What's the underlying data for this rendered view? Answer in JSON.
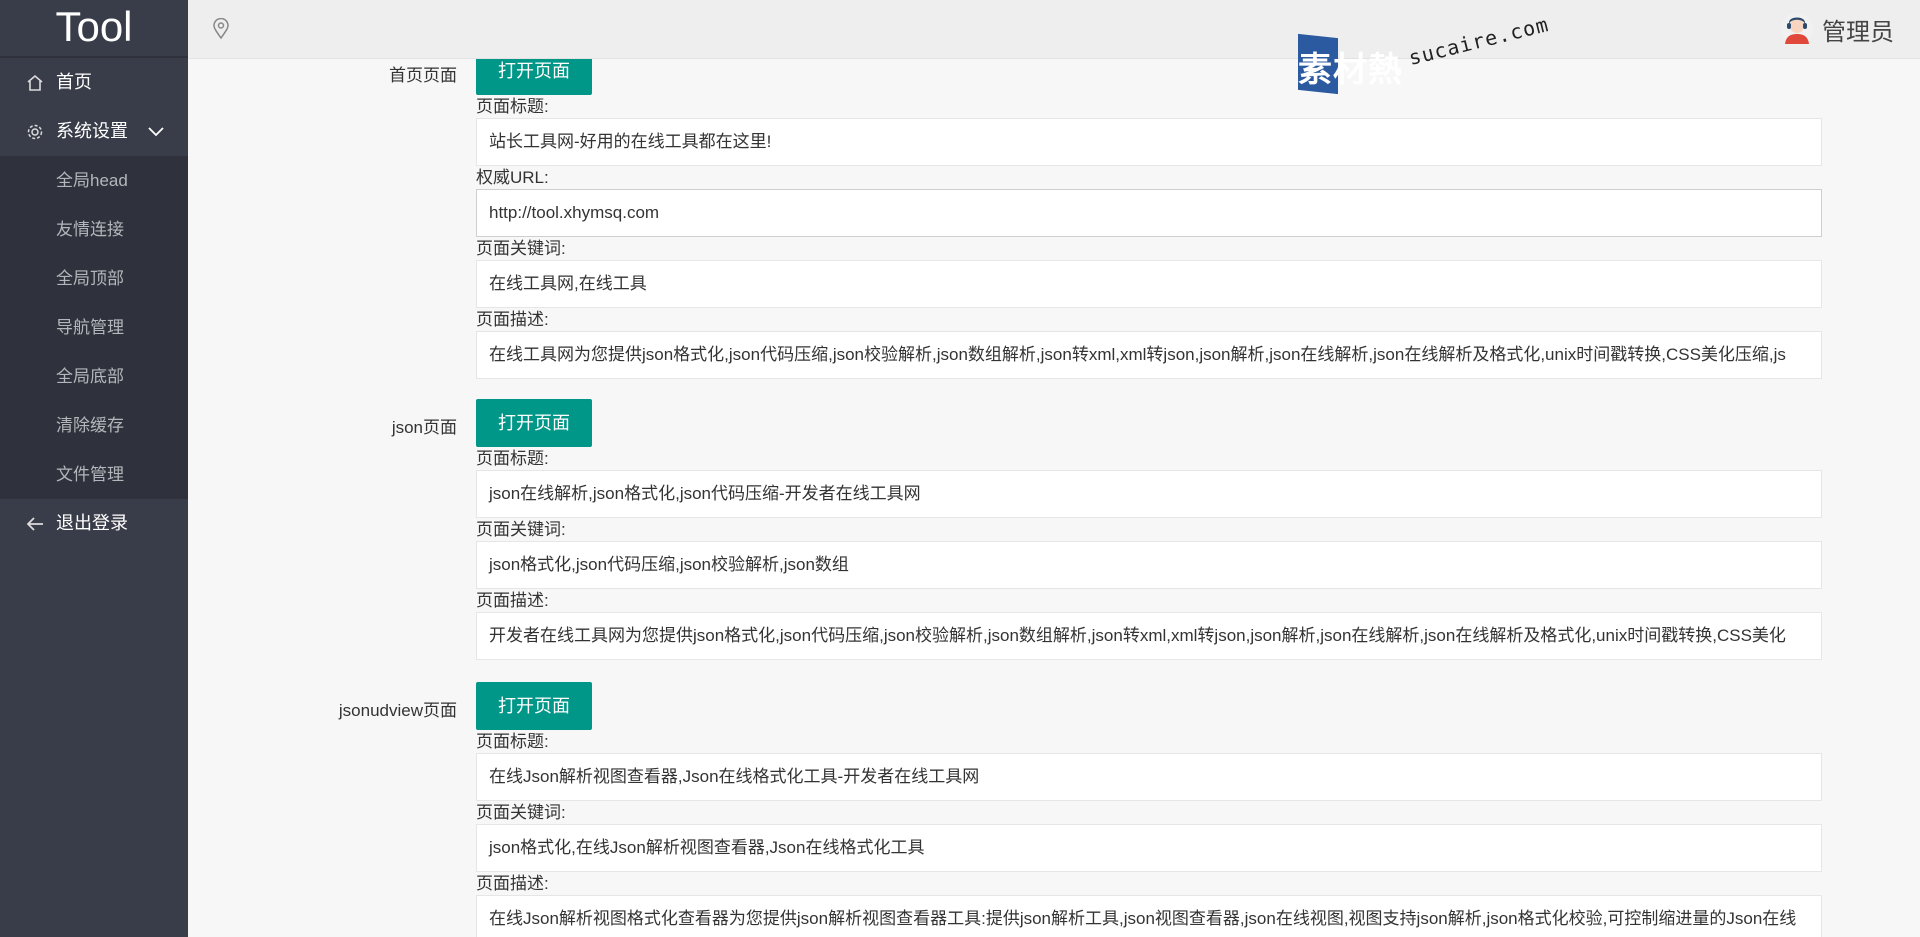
{
  "sidebar": {
    "logo": "Tool",
    "items": {
      "home": {
        "label": "首页",
        "icon": "home-icon"
      },
      "settings": {
        "label": "系统设置",
        "icon": "gear-icon"
      },
      "logout": {
        "label": "退出登录",
        "icon": "arrow-left-icon"
      }
    },
    "sub_items": [
      "全局head",
      "友情连接",
      "全局顶部",
      "导航管理",
      "全局底部",
      "清除缓存",
      "文件管理"
    ]
  },
  "header": {
    "location_icon": "location-pin-icon",
    "user_name": "管理员",
    "avatar_icon": "user-avatar-icon"
  },
  "watermark": {
    "brand_cn": "素材熱",
    "brand_en": "sucaire.com"
  },
  "colors": {
    "sidebar": "#393d49",
    "sidebar_sub": "#2f323c",
    "accent": "#009688"
  },
  "labels": {
    "title": "页面标题:",
    "canonical": "权威URL:",
    "keywords": "页面关键词:",
    "description": "页面描述:"
  },
  "open_button_label": "打开页面",
  "sections": [
    {
      "name": "首页页面",
      "title": "站长工具网-好用的在线工具都在这里!",
      "canonical": "http://tool.xhymsq.com",
      "keywords": "在线工具网,在线工具",
      "description": "在线工具网为您提供json格式化,json代码压缩,json校验解析,json数组解析,json转xml,xml转json,json解析,json在线解析,json在线解析及格式化,unix时间戳转换,CSS美化压缩,js"
    },
    {
      "name": "json页面",
      "title": "json在线解析,json格式化,json代码压缩-开发者在线工具网",
      "keywords": "json格式化,json代码压缩,json校验解析,json数组",
      "description": "开发者在线工具网为您提供json格式化,json代码压缩,json校验解析,json数组解析,json转xml,xml转json,json解析,json在线解析,json在线解析及格式化,unix时间戳转换,CSS美化"
    },
    {
      "name": "jsonudview页面",
      "title": "在线Json解析视图查看器,Json在线格式化工具-开发者在线工具网",
      "keywords": "json格式化,在线Json解析视图查看器,Json在线格式化工具",
      "description": "在线Json解析视图格式化查看器为您提供json解析视图查看器工具:提供json解析工具,json视图查看器,json在线视图,视图支持json解析,json格式化校验,可控制缩进量的Json在线"
    }
  ]
}
